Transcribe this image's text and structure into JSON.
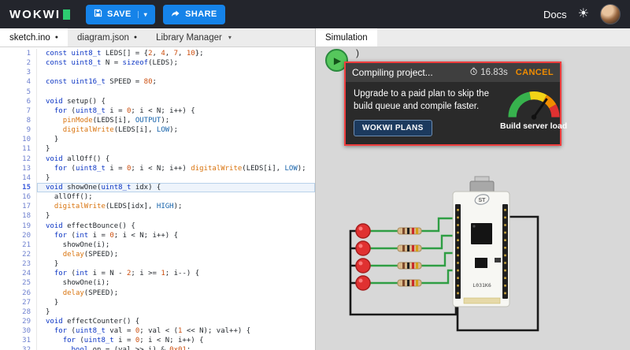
{
  "topbar": {
    "logo": "WOKWI",
    "save": "SAVE",
    "share": "SHARE",
    "docs": "Docs"
  },
  "icons": {
    "caret_down": "▾",
    "dirty_dot": "●",
    "play": "▶",
    "sun": "☀"
  },
  "colors": {
    "accent_blue": "#1583e9",
    "alert_red": "#f03e3e",
    "play_green": "#56c75c",
    "cancel_orange": "#f08c00",
    "wire_green": "#2f9e44",
    "led_red": "#e03131"
  },
  "tabs": {
    "files": [
      {
        "label": "sketch.ino",
        "dirty": true,
        "active": true
      },
      {
        "label": "diagram.json",
        "dirty": true,
        "active": false
      },
      {
        "label": "Library Manager",
        "dropdown": true,
        "active": false
      }
    ],
    "sim": [
      {
        "label": "Simulation",
        "active": true
      }
    ]
  },
  "editor": {
    "lines": [
      {
        "t": [
          [
            "k",
            "const"
          ],
          [
            "p",
            " "
          ],
          [
            "k",
            "uint8_t"
          ],
          [
            "p",
            " LEDS[] = {"
          ],
          [
            "n",
            "2"
          ],
          [
            "p",
            ", "
          ],
          [
            "n",
            "4"
          ],
          [
            "p",
            ", "
          ],
          [
            "n",
            "7"
          ],
          [
            "p",
            ", "
          ],
          [
            "n",
            "10"
          ],
          [
            "p",
            "};"
          ]
        ]
      },
      {
        "t": [
          [
            "k",
            "const"
          ],
          [
            "p",
            " "
          ],
          [
            "k",
            "uint8_t"
          ],
          [
            "p",
            " N = "
          ],
          [
            "k",
            "sizeof"
          ],
          [
            "p",
            "(LEDS);"
          ]
        ]
      },
      {
        "t": []
      },
      {
        "t": [
          [
            "k",
            "const"
          ],
          [
            "p",
            " "
          ],
          [
            "k",
            "uint16_t"
          ],
          [
            "p",
            " SPEED = "
          ],
          [
            "n",
            "80"
          ],
          [
            "p",
            ";"
          ]
        ]
      },
      {
        "t": []
      },
      {
        "t": [
          [
            "k",
            "void"
          ],
          [
            "p",
            " setup() {"
          ]
        ]
      },
      {
        "t": [
          [
            "p",
            "  "
          ],
          [
            "k",
            "for"
          ],
          [
            "p",
            " ("
          ],
          [
            "k",
            "uint8_t"
          ],
          [
            "p",
            " i = "
          ],
          [
            "n",
            "0"
          ],
          [
            "p",
            "; i < N; i++) {"
          ]
        ]
      },
      {
        "t": [
          [
            "p",
            "    "
          ],
          [
            "f",
            "pinMode"
          ],
          [
            "p",
            "(LEDS[i], "
          ],
          [
            "c",
            "OUTPUT"
          ],
          [
            "p",
            ");"
          ]
        ]
      },
      {
        "t": [
          [
            "p",
            "    "
          ],
          [
            "f",
            "digitalWrite"
          ],
          [
            "p",
            "(LEDS[i], "
          ],
          [
            "c",
            "LOW"
          ],
          [
            "p",
            ");"
          ]
        ]
      },
      {
        "t": [
          [
            "p",
            "  }"
          ]
        ]
      },
      {
        "t": [
          [
            "p",
            "}"
          ]
        ]
      },
      {
        "t": [
          [
            "k",
            "void"
          ],
          [
            "p",
            " allOff() {"
          ]
        ]
      },
      {
        "t": [
          [
            "p",
            "  "
          ],
          [
            "k",
            "for"
          ],
          [
            "p",
            " ("
          ],
          [
            "k",
            "uint8_t"
          ],
          [
            "p",
            " i = "
          ],
          [
            "n",
            "0"
          ],
          [
            "p",
            "; i < N; i++) "
          ],
          [
            "f",
            "digitalWrite"
          ],
          [
            "p",
            "(LEDS[i], "
          ],
          [
            "c",
            "LOW"
          ],
          [
            "p",
            ");"
          ]
        ]
      },
      {
        "t": [
          [
            "p",
            "}"
          ]
        ]
      },
      {
        "a": 1,
        "t": [
          [
            "k",
            "void"
          ],
          [
            "p",
            " showOne("
          ],
          [
            "k",
            "uint8_t"
          ],
          [
            "p",
            " idx) {"
          ]
        ]
      },
      {
        "t": [
          [
            "p",
            "  allOff();"
          ]
        ]
      },
      {
        "t": [
          [
            "p",
            "  "
          ],
          [
            "f",
            "digitalWrite"
          ],
          [
            "p",
            "(LEDS[idx], "
          ],
          [
            "c",
            "HIGH"
          ],
          [
            "p",
            ");"
          ]
        ]
      },
      {
        "t": [
          [
            "p",
            "}"
          ]
        ]
      },
      {
        "t": [
          [
            "k",
            "void"
          ],
          [
            "p",
            " effectBounce() {"
          ]
        ]
      },
      {
        "t": [
          [
            "p",
            "  "
          ],
          [
            "k",
            "for"
          ],
          [
            "p",
            " ("
          ],
          [
            "k",
            "int"
          ],
          [
            "p",
            " i = "
          ],
          [
            "n",
            "0"
          ],
          [
            "p",
            "; i < N; i++) {"
          ]
        ]
      },
      {
        "t": [
          [
            "p",
            "    showOne(i);"
          ]
        ]
      },
      {
        "t": [
          [
            "p",
            "    "
          ],
          [
            "f",
            "delay"
          ],
          [
            "p",
            "(SPEED);"
          ]
        ]
      },
      {
        "t": [
          [
            "p",
            "  }"
          ]
        ]
      },
      {
        "t": [
          [
            "p",
            "  "
          ],
          [
            "k",
            "for"
          ],
          [
            "p",
            " ("
          ],
          [
            "k",
            "int"
          ],
          [
            "p",
            " i = N - "
          ],
          [
            "n",
            "2"
          ],
          [
            "p",
            "; i >= "
          ],
          [
            "n",
            "1"
          ],
          [
            "p",
            "; i--) {"
          ]
        ]
      },
      {
        "t": [
          [
            "p",
            "    showOne(i);"
          ]
        ]
      },
      {
        "t": [
          [
            "p",
            "    "
          ],
          [
            "f",
            "delay"
          ],
          [
            "p",
            "(SPEED);"
          ]
        ]
      },
      {
        "t": [
          [
            "p",
            "  }"
          ]
        ]
      },
      {
        "t": [
          [
            "p",
            "}"
          ]
        ]
      },
      {
        "t": [
          [
            "k",
            "void"
          ],
          [
            "p",
            " effectCounter() {"
          ]
        ]
      },
      {
        "t": [
          [
            "p",
            "  "
          ],
          [
            "k",
            "for"
          ],
          [
            "p",
            " ("
          ],
          [
            "k",
            "uint8_t"
          ],
          [
            "p",
            " val = "
          ],
          [
            "n",
            "0"
          ],
          [
            "p",
            "; val < ("
          ],
          [
            "n",
            "1"
          ],
          [
            "p",
            " << N); val++) {"
          ]
        ]
      },
      {
        "t": [
          [
            "p",
            "    "
          ],
          [
            "k",
            "for"
          ],
          [
            "p",
            " ("
          ],
          [
            "k",
            "uint8_t"
          ],
          [
            "p",
            " i = "
          ],
          [
            "n",
            "0"
          ],
          [
            "p",
            "; i < N; i++) {"
          ]
        ]
      },
      {
        "t": [
          [
            "p",
            "      "
          ],
          [
            "k",
            "bool"
          ],
          [
            "p",
            " on = (val >> i) & "
          ],
          [
            "n",
            "0x01"
          ],
          [
            "p",
            ";"
          ]
        ]
      }
    ]
  },
  "simulation": {
    "stray_text": ")",
    "notification": {
      "title": "Compiling project...",
      "timer": "16.83s",
      "cancel": "CANCEL",
      "message": "Upgrade to a paid plan to skip the build queue and compile faster.",
      "cta": "WOKWI PLANS",
      "gauge_label": "Build server load"
    },
    "board": {
      "logo": "ST",
      "label": "L031K6"
    }
  }
}
